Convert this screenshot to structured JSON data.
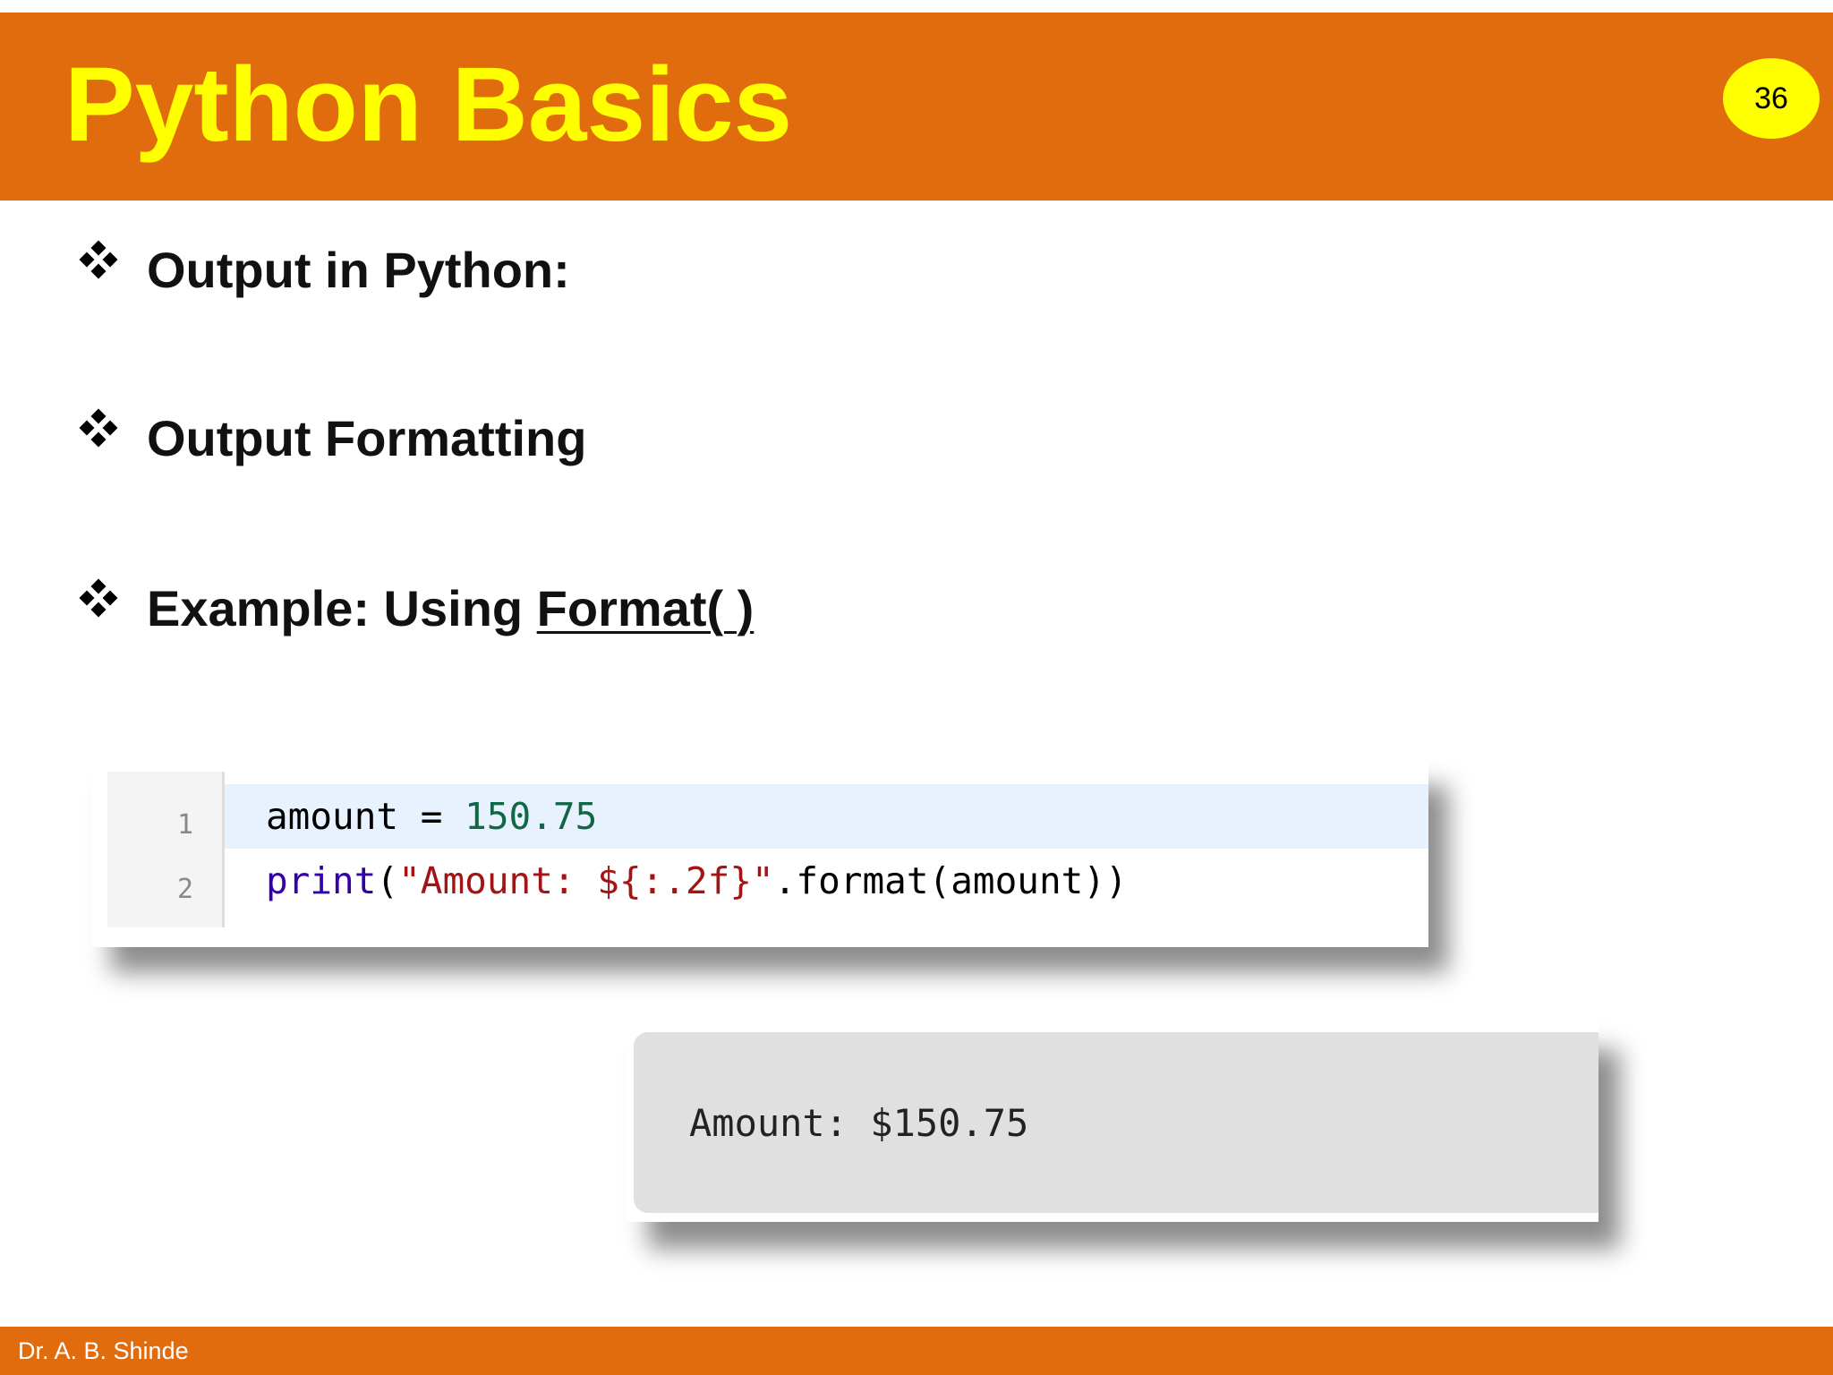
{
  "header": {
    "title": "Python Basics",
    "page_number": "36",
    "bar_color": "#e16c0e",
    "title_color": "#ffff00"
  },
  "bullets": [
    {
      "icon": "four-diamond-bullet-icon",
      "text": "Output in Python:"
    },
    {
      "icon": "four-diamond-bullet-icon",
      "text": "Output Formatting"
    },
    {
      "icon": "four-diamond-bullet-icon",
      "text_plain": "Example: Using ",
      "text_underlined": "Format( )"
    }
  ],
  "code": {
    "lines": [
      {
        "number": "1",
        "tokens": [
          {
            "text": "amount = ",
            "kind": "plain"
          },
          {
            "text": "150.75",
            "kind": "number"
          }
        ]
      },
      {
        "number": "2",
        "tokens": [
          {
            "text": "print",
            "kind": "keyword"
          },
          {
            "text": "(",
            "kind": "plain"
          },
          {
            "text": "\"Amount: ${:.2f}\"",
            "kind": "string"
          },
          {
            "text": ".format(amount))",
            "kind": "plain"
          }
        ]
      }
    ],
    "highlighted_line": "1"
  },
  "output": {
    "text": "Amount: $150.75"
  },
  "footer": {
    "author": "Dr. A. B. Shinde"
  }
}
